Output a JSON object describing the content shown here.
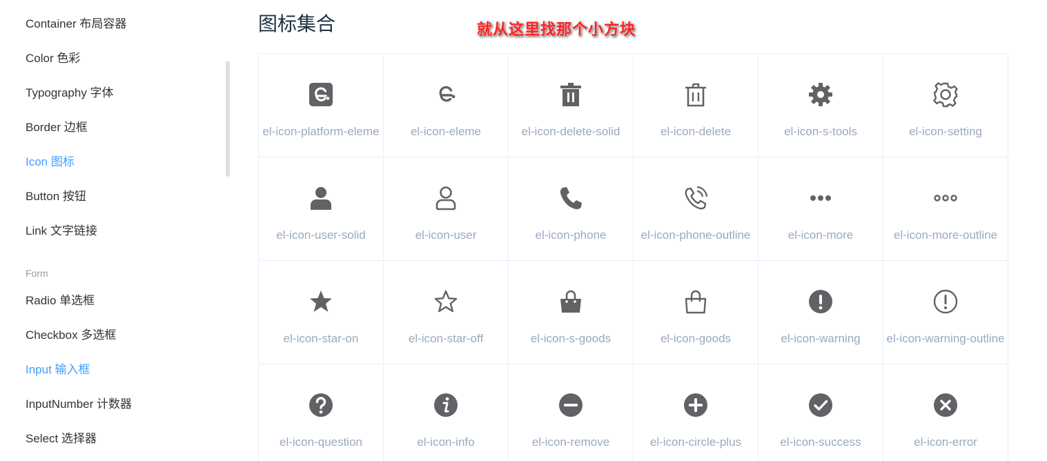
{
  "sidebar": {
    "items": [
      {
        "label": "Container 布局容器",
        "active": false
      },
      {
        "label": "Color 色彩",
        "active": false
      },
      {
        "label": "Typography 字体",
        "active": false
      },
      {
        "label": "Border 边框",
        "active": false
      },
      {
        "label": "Icon 图标",
        "active": true
      },
      {
        "label": "Button 按钮",
        "active": false
      },
      {
        "label": "Link 文字链接",
        "active": false
      }
    ],
    "group_title": "Form",
    "form_items": [
      {
        "label": "Radio 单选框",
        "active": false
      },
      {
        "label": "Checkbox 多选框",
        "active": false
      },
      {
        "label": "Input 输入框",
        "active": true
      },
      {
        "label": "InputNumber 计数器",
        "active": false
      },
      {
        "label": "Select 选择器",
        "active": false
      }
    ]
  },
  "main": {
    "title": "图标集合",
    "annotation": "就从这里找那个小方块",
    "icon_color": "#606266",
    "label_color": "#99a9bf",
    "active_color": "#409eff",
    "icons": [
      {
        "name": "el-icon-platform-eleme",
        "icon": "platform-eleme-icon"
      },
      {
        "name": "el-icon-eleme",
        "icon": "eleme-icon"
      },
      {
        "name": "el-icon-delete-solid",
        "icon": "delete-solid-icon"
      },
      {
        "name": "el-icon-delete",
        "icon": "delete-icon"
      },
      {
        "name": "el-icon-s-tools",
        "icon": "s-tools-icon"
      },
      {
        "name": "el-icon-setting",
        "icon": "setting-icon"
      },
      {
        "name": "el-icon-user-solid",
        "icon": "user-solid-icon"
      },
      {
        "name": "el-icon-user",
        "icon": "user-icon"
      },
      {
        "name": "el-icon-phone",
        "icon": "phone-icon"
      },
      {
        "name": "el-icon-phone-outline",
        "icon": "phone-outline-icon"
      },
      {
        "name": "el-icon-more",
        "icon": "more-icon"
      },
      {
        "name": "el-icon-more-outline",
        "icon": "more-outline-icon"
      },
      {
        "name": "el-icon-star-on",
        "icon": "star-on-icon"
      },
      {
        "name": "el-icon-star-off",
        "icon": "star-off-icon"
      },
      {
        "name": "el-icon-s-goods",
        "icon": "s-goods-icon"
      },
      {
        "name": "el-icon-goods",
        "icon": "goods-icon"
      },
      {
        "name": "el-icon-warning",
        "icon": "warning-icon"
      },
      {
        "name": "el-icon-warning-outline",
        "icon": "warning-outline-icon"
      },
      {
        "name": "el-icon-question",
        "icon": "question-icon"
      },
      {
        "name": "el-icon-info",
        "icon": "info-icon"
      },
      {
        "name": "el-icon-remove",
        "icon": "remove-icon"
      },
      {
        "name": "el-icon-circle-plus",
        "icon": "circle-plus-icon"
      },
      {
        "name": "el-icon-success",
        "icon": "success-icon"
      },
      {
        "name": "el-icon-error",
        "icon": "error-icon"
      }
    ]
  }
}
